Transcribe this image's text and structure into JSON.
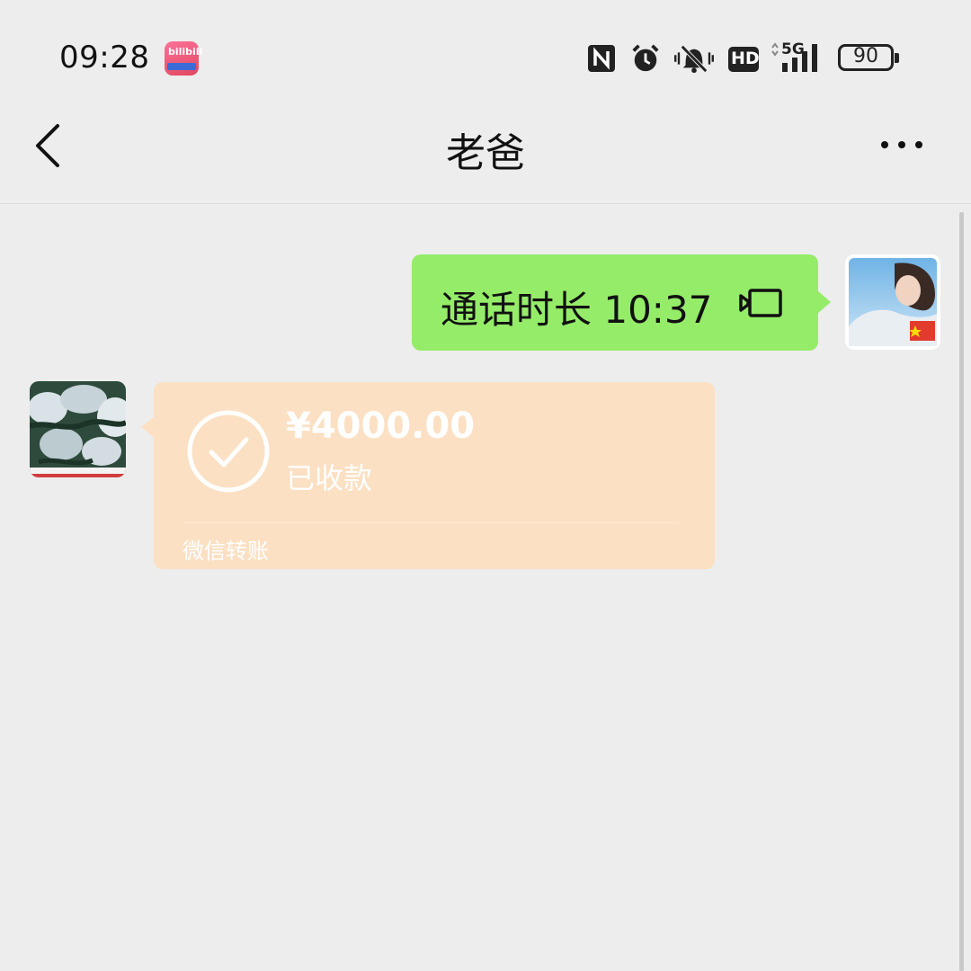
{
  "status_bar": {
    "time": "09:28",
    "app_icon_label": "bilibili",
    "icons": [
      "nfc-icon",
      "alarm-icon",
      "mute-icon",
      "hd-icon",
      "5g-signal-icon"
    ],
    "network": "5G",
    "hd": "HD",
    "battery": "90"
  },
  "header": {
    "title": "老爸",
    "back_icon": "chevron-left-icon",
    "more_icon": "more-dots-icon"
  },
  "messages": {
    "call": {
      "text": "通话时长 10:37",
      "icon": "video-call-icon",
      "color": "#95ec69"
    },
    "transfer": {
      "amount": "¥4000.00",
      "status": "已收款",
      "label": "微信转账",
      "color": "#fbe0c3"
    }
  }
}
